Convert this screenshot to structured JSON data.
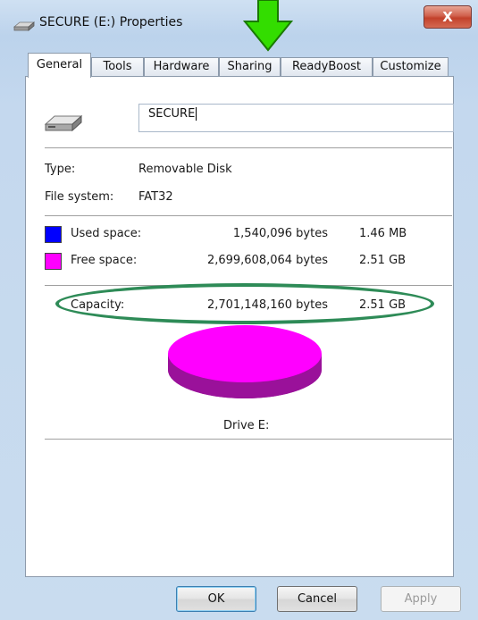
{
  "window": {
    "title": "SECURE (E:) Properties",
    "close_label": "X"
  },
  "tabs": [
    {
      "label": "General",
      "active": true
    },
    {
      "label": "Tools"
    },
    {
      "label": "Hardware"
    },
    {
      "label": "Sharing"
    },
    {
      "label": "ReadyBoost"
    },
    {
      "label": "Customize"
    }
  ],
  "general": {
    "volume_label": "SECURE",
    "type_label": "Type:",
    "type_value": "Removable Disk",
    "filesystem_label": "File system:",
    "filesystem_value": "FAT32",
    "used": {
      "label": "Used space:",
      "bytes": "1,540,096 bytes",
      "size": "1.46 MB",
      "color": "#0000ff"
    },
    "free": {
      "label": "Free space:",
      "bytes": "2,699,608,064 bytes",
      "size": "2.51 GB",
      "color": "#ff00ff"
    },
    "capacity": {
      "label": "Capacity:",
      "bytes": "2,701,148,160 bytes",
      "size": "2.51 GB"
    },
    "drive_caption": "Drive E:"
  },
  "annotation": {
    "arrow_color": "#33dd00",
    "highlight_color": "#2e8b57"
  },
  "buttons": {
    "ok": "OK",
    "cancel": "Cancel",
    "apply": "Apply"
  }
}
